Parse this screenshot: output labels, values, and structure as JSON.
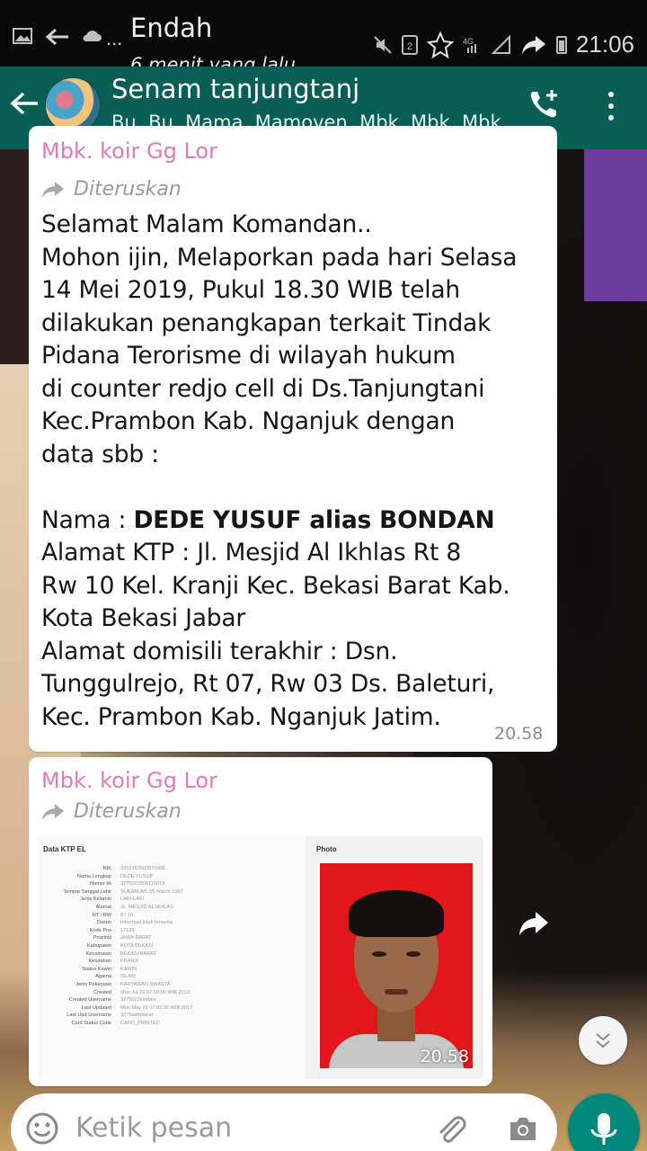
{
  "notification": {
    "app_icons": [
      "image-icon",
      "back-arrow-icon",
      "cloud-icon"
    ],
    "ellipsis": "...",
    "sender": "Endah",
    "subtext": "6 menit yang lalu"
  },
  "status_bar": {
    "icons": [
      "mute-icon",
      "sim-2-icon",
      "star-icon",
      "4g-signal-icon",
      "signal-icon",
      "share-icon",
      "battery-icon"
    ],
    "clock": "21:06"
  },
  "chat_header": {
    "title": "Senam tanjungtanj",
    "members": "Bu, Bu, Mama, Mamoven, Mbk, Mbk, Mbk..."
  },
  "messages": [
    {
      "sender": "Mbk. koir Gg Lor",
      "forwarded_label": "Diteruskan",
      "lines": [
        "Selamat Malam Komandan..",
        "Mohon ijin, Melaporkan pada hari Selasa",
        "14 Mei 2019, Pukul 18.30 WIB telah",
        "dilakukan penangkapan terkait Tindak",
        "Pidana Terorisme di wilayah hukum",
        "di counter redjo cell di Ds.Tanjungtani",
        "Kec.Prambon Kab. Nganjuk dengan",
        "data sbb :",
        "",
        "Alamat KTP : Jl. Mesjid Al Ikhlas Rt 8",
        "Rw 10 Kel. Kranji Kec. Bekasi Barat Kab.",
        "Kota Bekasi Jabar",
        "Alamat domisili terakhir : Dsn.",
        "Tunggulrejo, Rt 07, Rw 03 Ds. Baleturi,",
        "Kec. Prambon Kab. Nganjuk Jatim."
      ],
      "name_label": "Nama : ",
      "name_value": "DEDE YUSUF alias BONDAN",
      "time": "20.58"
    },
    {
      "sender": "Mbk. koir Gg Lor",
      "forwarded_label": "Diteruskan",
      "time": "20.58",
      "ktp": {
        "header": "Data KTP EL",
        "photo_label": "Photo",
        "rows": [
          {
            "k": "NIK",
            "v": "3202160503870006"
          },
          {
            "k": "Nama Lengkap",
            "v": "DEDE YUSUP"
          },
          {
            "k": "Nomor kk",
            "v": "3275022506110019"
          },
          {
            "k": "Tempat Tanggal Lahir",
            "v": "SUKABUMI, 05 March 1987"
          },
          {
            "k": "Jenis Kelamin",
            "v": "LAKI-LAKI"
          },
          {
            "k": "Alamat",
            "v": "JL. MESJID AL IKHLAS"
          },
          {
            "k": "RT / RW",
            "v": "8 / 10"
          },
          {
            "k": "Dusun",
            "v": "Informasi tidak tersedia"
          },
          {
            "k": "Kode Pos",
            "v": "17135"
          },
          {
            "k": "Propinsi",
            "v": "JAWA BARAT"
          },
          {
            "k": "Kabupaten",
            "v": "KOTA BEKASI"
          },
          {
            "k": "Kecamatan",
            "v": "BEKASI BARAT"
          },
          {
            "k": "Kelurahan",
            "v": "KRANJI"
          },
          {
            "k": "Status Kawin",
            "v": "KAWIN"
          },
          {
            "k": "Agama",
            "v": "ISLAM"
          },
          {
            "k": "Jenis Pekerjaan",
            "v": "KARYAWAN SWASTA"
          },
          {
            "k": "Created",
            "v": "Mon Jul 22 07:00:00 WIB 2013"
          },
          {
            "k": "Created Username",
            "v": "3275022kimbes"
          },
          {
            "k": "Last Updated",
            "v": "Mon May 29 07:00:00 WIB 2017"
          },
          {
            "k": "Last Upd Username",
            "v": "3275admbarat"
          },
          {
            "k": "Card Status Code",
            "v": "CARD_PRINTED"
          }
        ]
      }
    }
  ],
  "input": {
    "placeholder": "Ketik pesan"
  },
  "colors": {
    "app_bar": "#075e54",
    "sender_name": "#e07bb5",
    "fab": "#00897b"
  }
}
